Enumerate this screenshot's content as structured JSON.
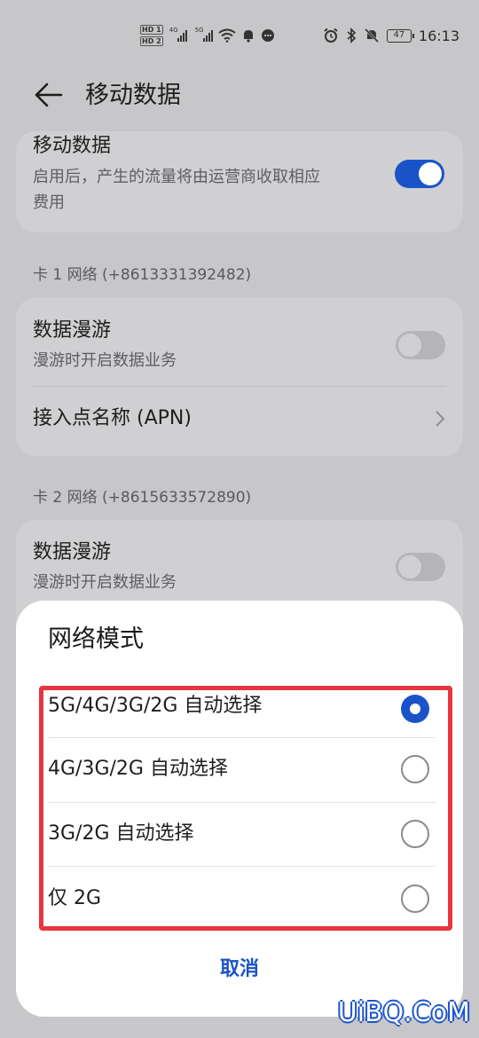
{
  "status_bar": {
    "hd1": "HD 1",
    "hd2": "HD 2",
    "net1": "4G",
    "net2": "5G",
    "battery": "47",
    "time": "16:13",
    "icons": [
      "wifi-icon",
      "notification-bell-icon",
      "message-icon",
      "alarm-icon",
      "bluetooth-icon",
      "mute-icon"
    ]
  },
  "header": {
    "title": "移动数据"
  },
  "mobile_data": {
    "title": "移动数据",
    "description_line1": "启用后，产生的流量将由运营商收取相应",
    "description_line2": "费用",
    "enabled": true
  },
  "sim1": {
    "label": "卡 1 网络 (+8613331392482)",
    "roaming_title": "数据漫游",
    "roaming_desc": "漫游时开启数据业务",
    "roaming_enabled": false,
    "apn_label": "接入点名称 (APN)"
  },
  "sim2": {
    "label": "卡 2 网络 (+8615633572890)",
    "roaming_title": "数据漫游",
    "roaming_desc": "漫游时开启数据业务",
    "roaming_enabled": false
  },
  "dialog": {
    "title": "网络模式",
    "options": [
      {
        "label": "5G/4G/3G/2G 自动选择",
        "selected": true
      },
      {
        "label": "4G/3G/2G 自动选择",
        "selected": false
      },
      {
        "label": "3G/2G 自动选择",
        "selected": false
      },
      {
        "label": "仅 2G",
        "selected": false
      }
    ],
    "cancel_label": "取消"
  },
  "watermark": "UiBQ.CoM",
  "colors": {
    "accent": "#1a53c9",
    "highlight_border": "#e8363c",
    "dim_background": "#c7c7c9"
  }
}
